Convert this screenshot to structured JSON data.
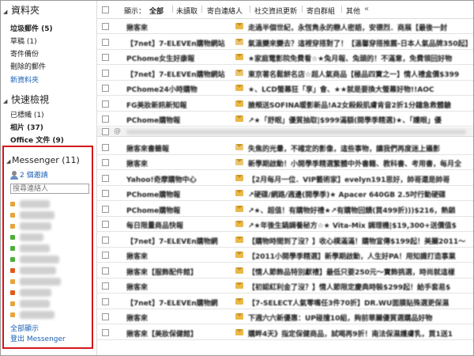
{
  "sidebar": {
    "folders_title": "資料夾",
    "folders": [
      {
        "label": "垃圾郵件 (5)",
        "bold": true
      },
      {
        "label": "草稿 (1)",
        "bold": false
      },
      {
        "label": "寄件備份",
        "bold": false
      },
      {
        "label": "刪除的郵件",
        "bold": false
      }
    ],
    "new_folder": "新資料夾",
    "quick_title": "快速檢視",
    "quick": [
      {
        "label": "已標幟 (1)",
        "bold": false
      },
      {
        "label": "相片 (37)",
        "bold": true
      },
      {
        "label": "Office 文件 (9)",
        "bold": true
      }
    ]
  },
  "messenger": {
    "title": "Messenger (11)",
    "invites": "2 個邀請",
    "search_placeholder": "搜尋連絡人",
    "contacts": [
      {
        "status": "away",
        "color": "#e8a33a"
      },
      {
        "status": "away",
        "color": "#e8a33a"
      },
      {
        "status": "away",
        "color": "#e8a33a"
      },
      {
        "status": "online",
        "color": "#4caf3a"
      },
      {
        "status": "online",
        "color": "#4caf3a"
      },
      {
        "status": "online",
        "color": "#4caf3a"
      },
      {
        "status": "busy",
        "color": "#e05a1a"
      },
      {
        "status": "away",
        "color": "#e8a33a"
      },
      {
        "status": "busy",
        "color": "#e05a1a"
      },
      {
        "status": "away",
        "color": "#e8a33a"
      },
      {
        "status": "away",
        "color": "#e8a33a"
      }
    ],
    "show_all": "全部顯示",
    "logout": "登出 Messenger"
  },
  "filter": {
    "label": "顯示：",
    "options": [
      "全部",
      "未讀取",
      "寄自連絡人",
      "社交資訊更新",
      "寄自群組",
      "其他"
    ],
    "more": "«"
  },
  "messages_top": [
    {
      "sender": "揪客來",
      "subject": "走過半個世紀，永恆雋永的戀人密語，安德烈．商展【最後一封"
    },
    {
      "sender": "【7net】7-ELEVEn購物網站",
      "subject": "氣溫變來變去？這裡穿搭對了！【溫馨穿搭推薦-日本人氣品牌350起】"
    },
    {
      "sender": "PChome女生好康報",
      "subject": "★家庭電影院免費看☆★兔月報、兔頭的！不滿意，免費領回好物"
    },
    {
      "sender": "【7net】7-ELEVEn購物網站",
      "subject": "東京著名鬆餅名店☆超人氣商品【極品四寶之一】情人禮盒價$399"
    },
    {
      "sender": "PChome24小時購物",
      "subject": "★、LCD螢幕狂「享」會、★★就是要換大螢幕好物!!AOC"
    },
    {
      "sender": "FG美妝新訊新知報",
      "subject": "臉頰送SOFINA暖影新品!A2女殺殺肌膚肯音2折1分鐘急救體驗"
    },
    {
      "sender": "PChome購物報",
      "subject": "↗★「舒眠」優質抽取|$999滿額(開學季精選)★、「護眼」優"
    }
  ],
  "messages_bottom": [
    {
      "sender": "揪客來書籤報",
      "subject": "失焦的光暈，不確定的影像，這些事物，讓我們再度迷上攝影"
    },
    {
      "sender": "揪客來",
      "subject": "新學期啟動！小開學季精選繁體中外書籍、教科書、考用書，每月全"
    },
    {
      "sender": "Yahoo!奇摩購物中心",
      "subject": "【2月每月一位．VIP藝術家】evelyn191思好，帥哥還是帥哥"
    },
    {
      "sender": "PChome購物報",
      "subject": "↗硬碟/網路/週邊(開學季)★ Apacer 640GB 2.5吋行動硬碟"
    },
    {
      "sender": "PChome購物報",
      "subject": "↗★、超值！有購物好禮★↗有購物回饋(買499折)))$216，熱銷"
    },
    {
      "sender": "每日限量商品快報",
      "subject": "↗★年後生鍋調養秘方☆★ Vita-Mix 調理機|$19,300+送價值$"
    },
    {
      "sender": "【7net】7-ELEVEn購物網",
      "subject": "【購物時間到了沒？】收心樸滿滿！購物宣傳$199起！美麗2011～"
    },
    {
      "sender": "揪客來",
      "subject": "【2011小開學季精選】新學期啟動，人生好PA！用知識打造事業"
    },
    {
      "sender": "揪客來【服飾配件館】",
      "subject": "【情人節飾品特別獻禮】最低只要250元～寶飾挑選，時尚就這樣"
    },
    {
      "sender": "揪客來",
      "subject": "【初認紅利金了沒？】情人節限定慶典時裝$299起！給手套易$"
    },
    {
      "sender": "【7net】7-ELEVEn購物網",
      "subject": "【7-SELECT人氣零嘴任3件70折】DR.WU面膜貼殊選更保濕"
    },
    {
      "sender": "揪客來",
      "subject": "下週六六新優惠：UP碰撞10組，夠前華麗優質選購品好物"
    },
    {
      "sender": "揪客來【美妝保健館】",
      "subject": "購畔4天》指定保健商品，試喝再9折！南法保濕護膚乳，買1送1"
    }
  ]
}
